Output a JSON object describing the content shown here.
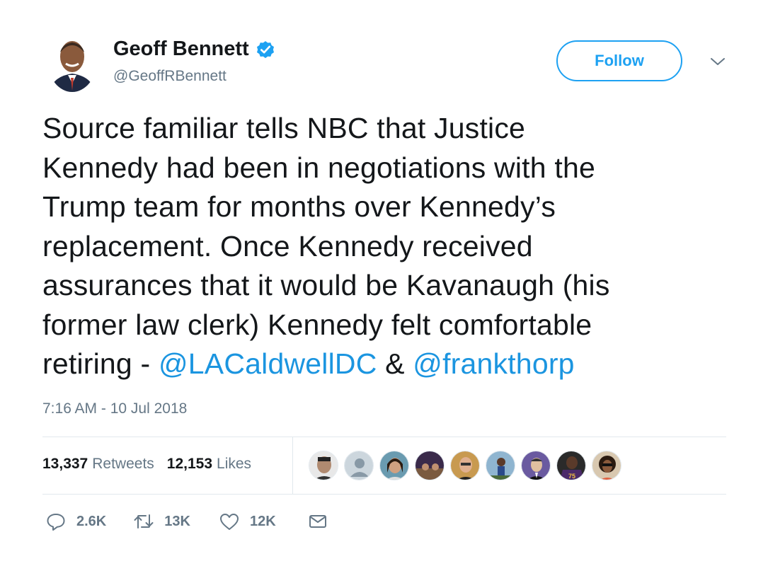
{
  "author": {
    "name": "Geoff Bennett",
    "handle": "@GeoffRBennett",
    "verified": true
  },
  "header": {
    "follow_label": "Follow",
    "more_icon": "chevron-down-icon"
  },
  "tweet": {
    "text_lines": [
      "Source familiar tells NBC that Justice",
      "Kennedy had been in negotiations with the",
      "Trump team for months over Kennedy’s",
      "replacement. Once Kennedy received",
      "assurances that it would be Kavanaugh (his",
      "former law clerk) Kennedy felt comfortable"
    ],
    "last_line_prefix": "retiring - ",
    "mention_1": "@LACaldwellDC",
    "joiner": " & ",
    "mention_2": "@frankthorp",
    "timestamp": "7:16 AM - 10 Jul 2018"
  },
  "stats": {
    "retweets_count": "13,337",
    "retweets_label": "Retweets",
    "likes_count": "12,153",
    "likes_label": "Likes"
  },
  "actions": {
    "reply_count": "2.6K",
    "retweet_count": "13K",
    "like_count": "12K"
  },
  "colors": {
    "accent": "#1da1f2",
    "link": "#1b95e0",
    "muted": "#657786",
    "text": "#14171a"
  }
}
